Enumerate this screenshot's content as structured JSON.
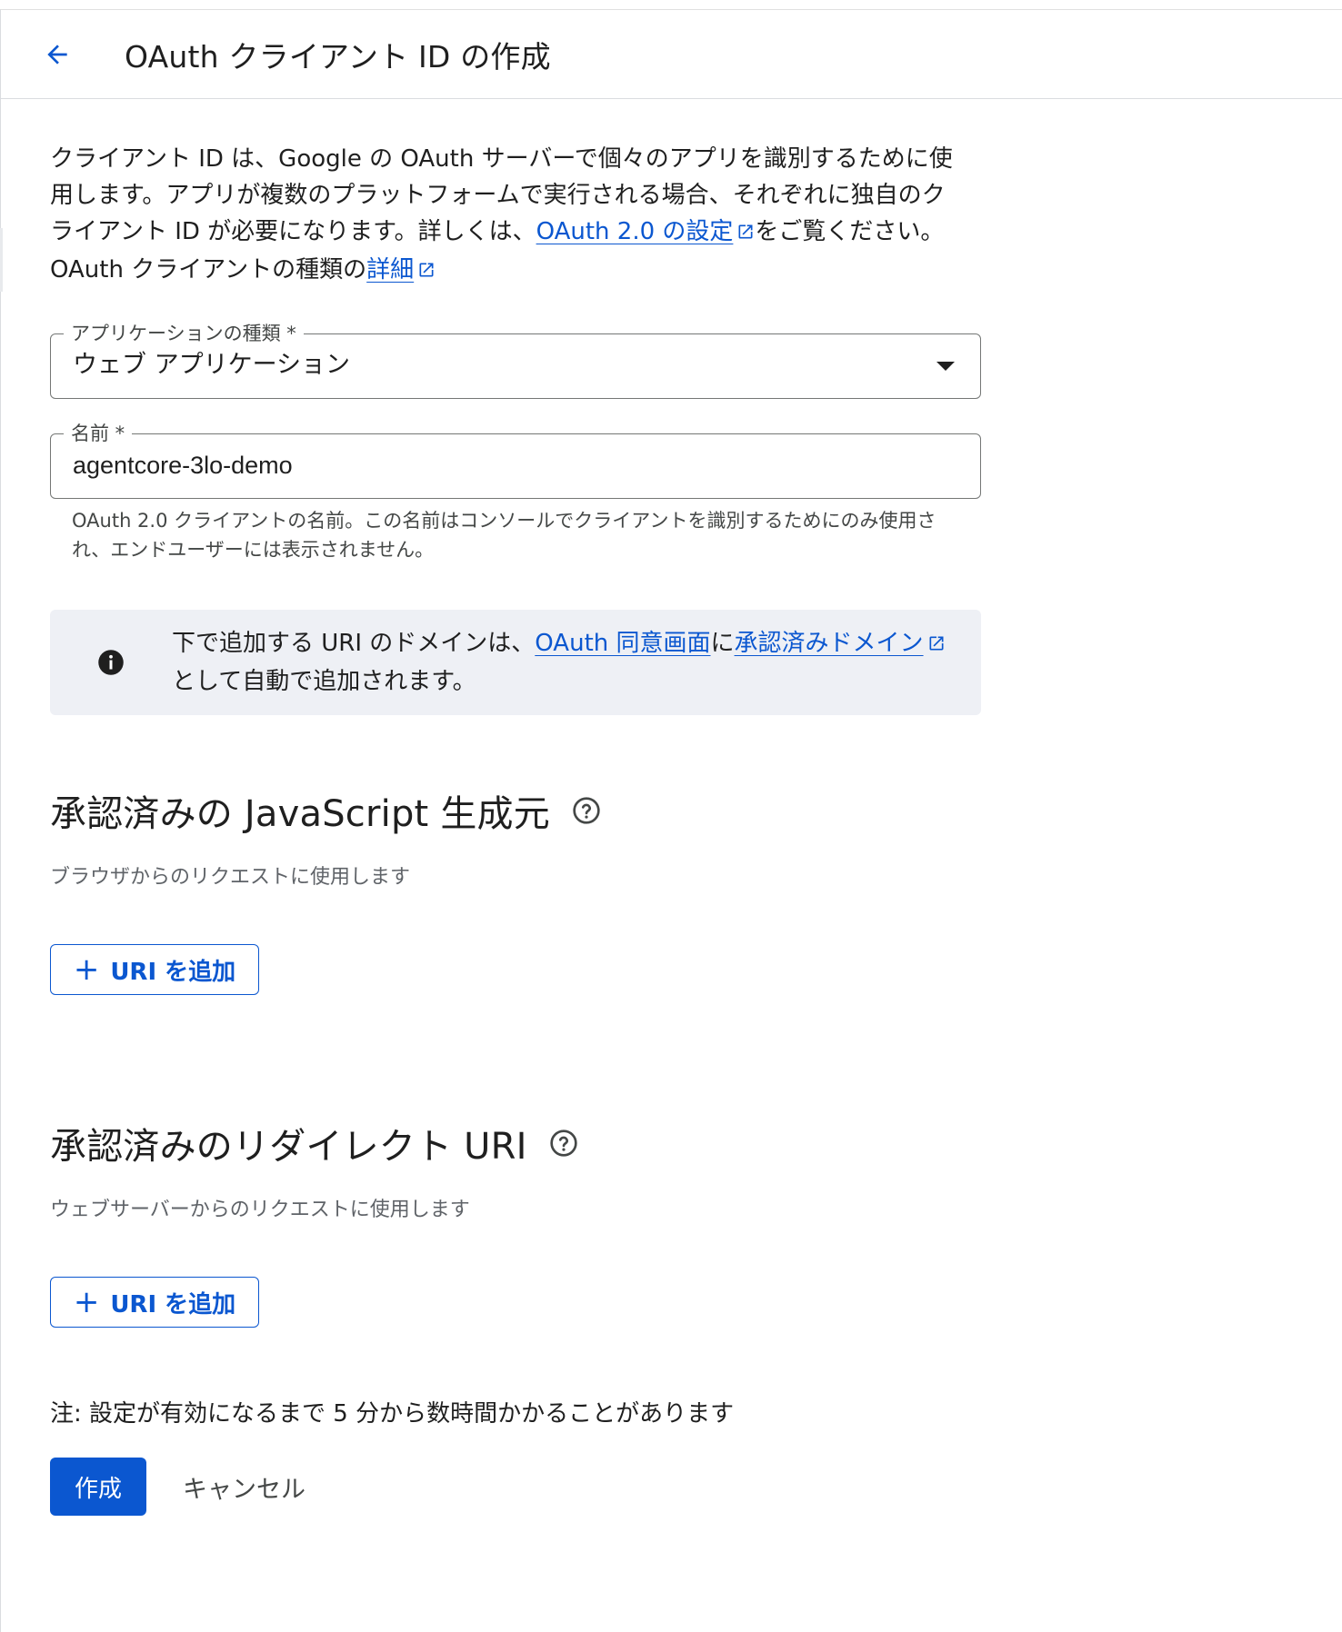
{
  "header": {
    "title": "OAuth クライアント ID の作成"
  },
  "intro": {
    "text_1": "クライアント ID は、Google の OAuth サーバーで個々のアプリを識別するために使用します。アプリが複数のプラットフォームで実行される場合、それぞれに独自のクライアント ID が必要になります。詳しくは、",
    "link_1": "OAuth 2.0 の設定",
    "text_2": "をご覧ください。 OAuth クライアントの種類の",
    "link_2": "詳細"
  },
  "app_type": {
    "label": "アプリケーションの種類 *",
    "value": "ウェブ アプリケーション"
  },
  "name_field": {
    "label": "名前 *",
    "value": "agentcore-3lo-demo",
    "helper": "OAuth 2.0 クライアントの名前。この名前はコンソールでクライアントを識別するためにのみ使用され、エンドユーザーには表示されません。"
  },
  "info": {
    "text_1": "下で追加する URI のドメインは、",
    "link_1": "OAuth 同意画面",
    "text_2": "に",
    "link_2": "承認済みドメイン",
    "text_3": "として自動で追加されます。"
  },
  "js_origins": {
    "title": "承認済みの JavaScript 生成元",
    "subtitle": "ブラウザからのリクエストに使用します",
    "add_label": "URI を追加"
  },
  "redirect_uris": {
    "title": "承認済みのリダイレクト URI",
    "subtitle": "ウェブサーバーからのリクエストに使用します",
    "add_label": "URI を追加"
  },
  "note": "注: 設定が有効になるまで 5 分から数時間かかることがあります",
  "actions": {
    "create": "作成",
    "cancel": "キャンセル"
  },
  "colors": {
    "accent": "#0b57d0",
    "info_bg": "#eef0f5",
    "border": "#747775"
  }
}
